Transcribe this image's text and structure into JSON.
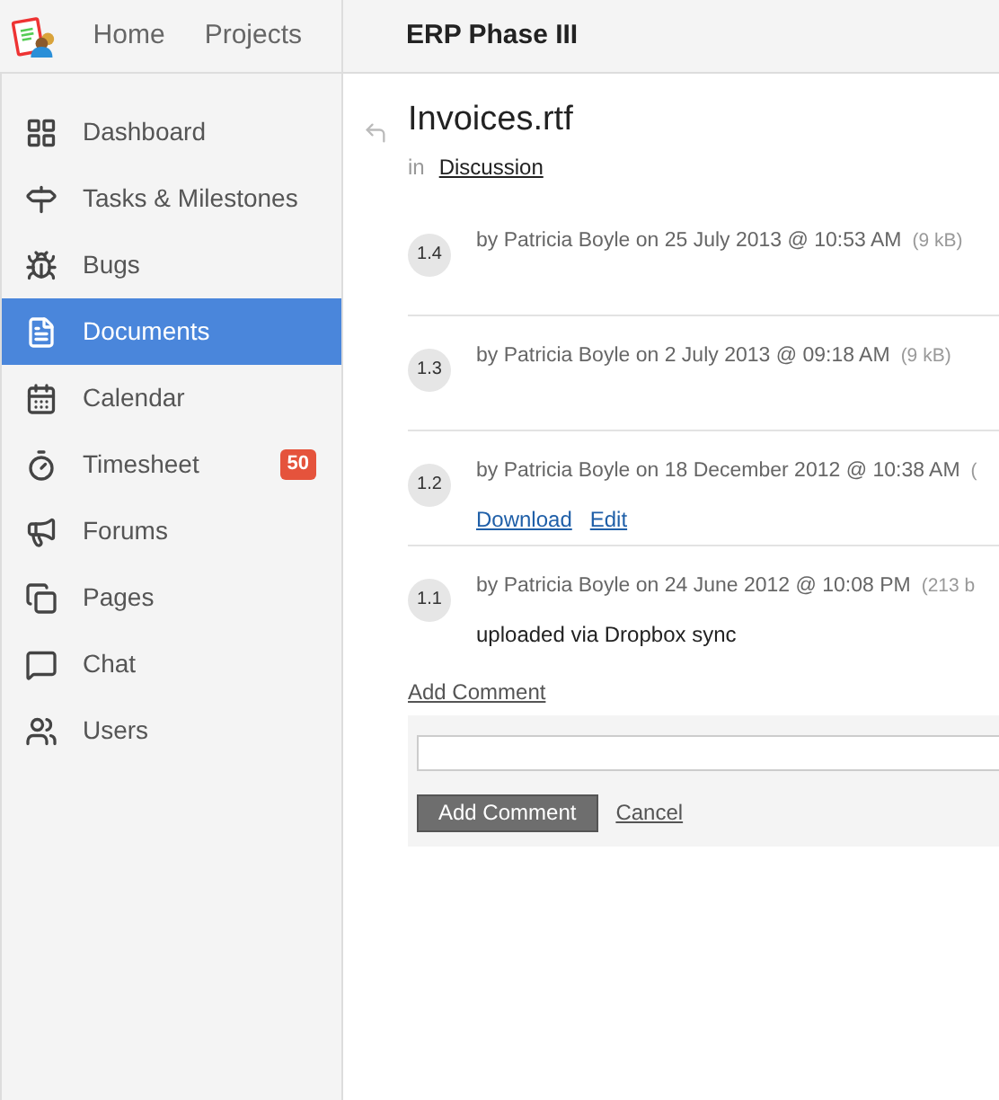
{
  "top_nav": [
    {
      "label": "Home"
    },
    {
      "label": "Projects"
    }
  ],
  "project_title": "ERP Phase III",
  "sidebar": {
    "items": [
      {
        "label": "Dashboard",
        "selected": false
      },
      {
        "label": "Tasks & Milestones",
        "selected": false
      },
      {
        "label": "Bugs",
        "selected": false
      },
      {
        "label": "Documents",
        "selected": true
      },
      {
        "label": "Calendar",
        "selected": false
      },
      {
        "label": "Timesheet",
        "selected": false,
        "badge": "50"
      },
      {
        "label": "Forums",
        "selected": false
      },
      {
        "label": "Pages",
        "selected": false
      },
      {
        "label": "Chat",
        "selected": false
      },
      {
        "label": "Users",
        "selected": false
      }
    ]
  },
  "document": {
    "title": "Invoices.rtf",
    "in_label": "in",
    "folder": "Discussion"
  },
  "versions": [
    {
      "version": "1.4",
      "meta": "by Patricia Boyle on 25 July 2013 @ 10:53 AM",
      "size": "(9 kB)"
    },
    {
      "version": "1.3",
      "meta": "by Patricia Boyle on 2 July 2013 @ 09:18 AM",
      "size": "(9 kB)"
    },
    {
      "version": "1.2",
      "meta": "by Patricia Boyle on 18 December 2012 @ 10:38 AM",
      "size": "(",
      "links": [
        "Download",
        "Edit"
      ]
    },
    {
      "version": "1.1",
      "meta": "by Patricia Boyle on 24 June 2012 @ 10:08 PM",
      "size": "(213 b",
      "note": "uploaded via Dropbox sync"
    }
  ],
  "comment": {
    "link": "Add Comment",
    "button": "Add Comment",
    "cancel": "Cancel"
  }
}
